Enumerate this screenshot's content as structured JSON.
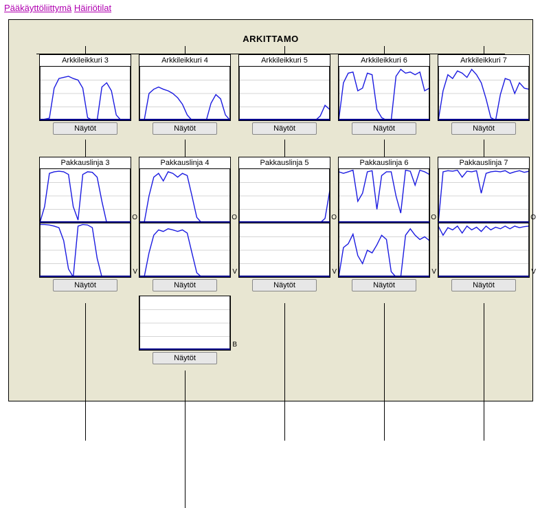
{
  "nav": {
    "main_ui": "Pääkäyttöliittymä",
    "fault_states": "Häiriötilat"
  },
  "title": "ARKITTAMO",
  "button_label": "Näytöt",
  "labels": {
    "O": "O",
    "V": "V",
    "B": "B"
  },
  "columns": [
    {
      "cutter_title": "Arkkileikkuri 3",
      "line_title": "Pakkauslinja 3",
      "has_blank": false
    },
    {
      "cutter_title": "Arkkileikkuri 4",
      "line_title": "Pakkauslinja 4",
      "has_blank": true
    },
    {
      "cutter_title": "Arkkileikkuri 5",
      "line_title": "Pakkauslinja 5",
      "has_blank": false
    },
    {
      "cutter_title": "Arkkileikkuri 6",
      "line_title": "Pakkauslinja 6",
      "has_blank": false
    },
    {
      "cutter_title": "Arkkileikkuri 7",
      "line_title": "Pakkauslinja 7",
      "has_blank": false
    }
  ],
  "chart_data": [
    {
      "id": "cutter-3",
      "type": "line",
      "ylim": [
        0,
        100
      ],
      "values": [
        0,
        2,
        4,
        60,
        78,
        80,
        82,
        78,
        75,
        60,
        5,
        0,
        0,
        62,
        70,
        55,
        10,
        0,
        0,
        0
      ]
    },
    {
      "id": "cutter-4",
      "type": "line",
      "ylim": [
        0,
        100
      ],
      "values": [
        0,
        0,
        50,
        58,
        62,
        58,
        55,
        50,
        42,
        30,
        10,
        0,
        0,
        0,
        0,
        32,
        48,
        40,
        10,
        0
      ]
    },
    {
      "id": "cutter-5",
      "type": "line",
      "ylim": [
        0,
        100
      ],
      "values": [
        0,
        0,
        0,
        0,
        0,
        0,
        0,
        0,
        0,
        0,
        0,
        0,
        0,
        0,
        0,
        0,
        0,
        8,
        28,
        20
      ]
    },
    {
      "id": "cutter-6",
      "type": "line",
      "ylim": [
        0,
        100
      ],
      "values": [
        0,
        70,
        88,
        90,
        55,
        60,
        88,
        85,
        20,
        5,
        0,
        0,
        82,
        95,
        88,
        90,
        85,
        90,
        55,
        60
      ]
    },
    {
      "id": "cutter-7",
      "type": "line",
      "ylim": [
        0,
        100
      ],
      "values": [
        0,
        55,
        85,
        78,
        92,
        88,
        80,
        95,
        85,
        70,
        40,
        5,
        0,
        48,
        78,
        75,
        50,
        70,
        60,
        58
      ]
    },
    {
      "id": "line-3-O",
      "type": "line",
      "ylim": [
        0,
        100
      ],
      "values": [
        0,
        30,
        92,
        95,
        96,
        95,
        90,
        30,
        5,
        90,
        95,
        94,
        85,
        40,
        0,
        0,
        0,
        0,
        0,
        0
      ]
    },
    {
      "id": "line-3-V",
      "type": "line",
      "ylim": [
        0,
        100
      ],
      "values": [
        98,
        98,
        97,
        95,
        92,
        68,
        15,
        0,
        95,
        98,
        97,
        92,
        35,
        0,
        0,
        0,
        0,
        0,
        0,
        0
      ]
    },
    {
      "id": "line-4-O",
      "type": "line",
      "ylim": [
        0,
        100
      ],
      "values": [
        0,
        0,
        50,
        85,
        92,
        78,
        95,
        92,
        85,
        92,
        88,
        50,
        10,
        0,
        0,
        0,
        0,
        0,
        0,
        0
      ]
    },
    {
      "id": "line-4-V",
      "type": "line",
      "ylim": [
        0,
        100
      ],
      "values": [
        0,
        0,
        45,
        78,
        88,
        85,
        90,
        88,
        85,
        88,
        82,
        45,
        8,
        0,
        0,
        0,
        0,
        0,
        0,
        0
      ]
    },
    {
      "id": "line-5-O",
      "type": "line",
      "ylim": [
        0,
        100
      ],
      "values": [
        0,
        0,
        0,
        0,
        0,
        0,
        0,
        0,
        0,
        0,
        0,
        0,
        0,
        0,
        0,
        0,
        0,
        0,
        8,
        60
      ]
    },
    {
      "id": "line-5-V",
      "type": "line",
      "ylim": [
        0,
        100
      ],
      "values": [
        0,
        0,
        0,
        0,
        0,
        0,
        0,
        0,
        0,
        0,
        0,
        0,
        0,
        0,
        0,
        0,
        0,
        0,
        0,
        0
      ]
    },
    {
      "id": "line-6-O",
      "type": "line",
      "ylim": [
        0,
        100
      ],
      "values": [
        95,
        92,
        95,
        98,
        40,
        55,
        95,
        97,
        25,
        88,
        95,
        95,
        50,
        18,
        98,
        96,
        70,
        98,
        95,
        90
      ]
    },
    {
      "id": "line-6-V",
      "type": "line",
      "ylim": [
        0,
        100
      ],
      "values": [
        0,
        55,
        62,
        80,
        40,
        25,
        50,
        45,
        60,
        78,
        70,
        10,
        0,
        0,
        78,
        90,
        78,
        70,
        75,
        68
      ]
    },
    {
      "id": "line-7-O",
      "type": "line",
      "ylim": [
        0,
        100
      ],
      "values": [
        0,
        95,
        97,
        96,
        98,
        85,
        96,
        95,
        97,
        55,
        92,
        95,
        96,
        95,
        97,
        92,
        95,
        97,
        94,
        96
      ]
    },
    {
      "id": "line-7-V",
      "type": "line",
      "ylim": [
        0,
        100
      ],
      "values": [
        95,
        78,
        92,
        88,
        95,
        82,
        95,
        88,
        93,
        85,
        95,
        88,
        93,
        90,
        95,
        90,
        95,
        92,
        94,
        95
      ]
    },
    {
      "id": "line-4-B",
      "type": "line",
      "ylim": [
        0,
        100
      ],
      "values": [
        0,
        0,
        0,
        0,
        0,
        0,
        0,
        0,
        0,
        0,
        0,
        0,
        0,
        0,
        0,
        0,
        0,
        0,
        0,
        0
      ]
    }
  ]
}
